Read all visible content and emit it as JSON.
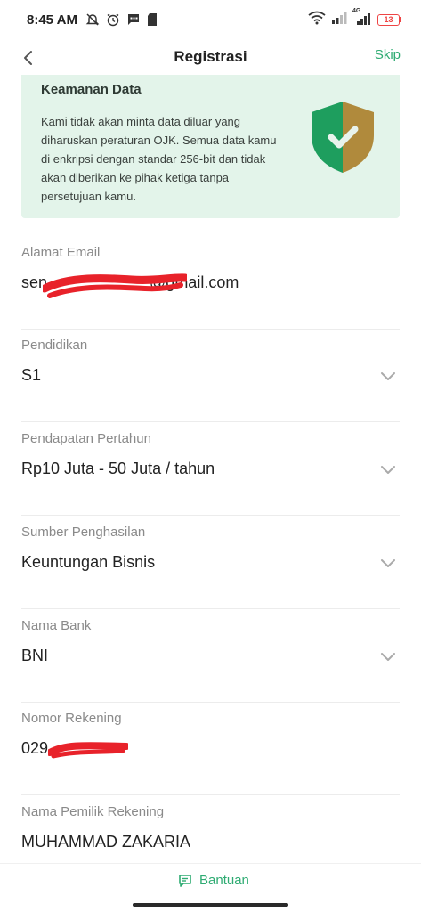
{
  "status_bar": {
    "time": "8:45 AM",
    "network_label": "4G",
    "battery_level": "13",
    "icons": [
      "muted-bell-icon",
      "alarm-icon",
      "message-icon",
      "sd-card-icon",
      "wifi-icon",
      "signal-icon",
      "signal-4g-icon",
      "battery-icon"
    ]
  },
  "header": {
    "title": "Registrasi",
    "skip_label": "Skip",
    "back_icon": "chevron-left-icon"
  },
  "security_card": {
    "title": "Keamanan Data",
    "text": "Kami tidak akan minta data diluar yang diharuskan peraturan OJK. Semua data kamu di enkripsi dengan standar 256-bit dan tidak akan diberikan ke pihak ketiga tanpa persetujuan kamu.",
    "icon": "shield-check-icon",
    "colors": {
      "background": "#e3f4ea",
      "shield_left": "#1e9e5e",
      "shield_right": "#b08a3c"
    }
  },
  "form": {
    "email": {
      "label": "Alamat Email",
      "value_prefix": "sen",
      "value_suffix": "@gmail.com"
    },
    "education": {
      "label": "Pendidikan",
      "value": "S1"
    },
    "income": {
      "label": "Pendapatan Pertahun",
      "value": "Rp10 Juta - 50 Juta / tahun"
    },
    "income_source": {
      "label": "Sumber Penghasilan",
      "value": "Keuntungan Bisnis"
    },
    "bank": {
      "label": "Nama Bank",
      "value": "BNI"
    },
    "account_number": {
      "label": "Nomor Rekening",
      "value_prefix": "029"
    },
    "account_holder": {
      "label": "Nama Pemilik Rekening",
      "value": "MUHAMMAD ZAKARIA"
    }
  },
  "footer": {
    "help_label": "Bantuan",
    "help_icon": "chat-help-icon"
  },
  "colors": {
    "accent": "#2eab72",
    "redaction": "#e8222a"
  }
}
